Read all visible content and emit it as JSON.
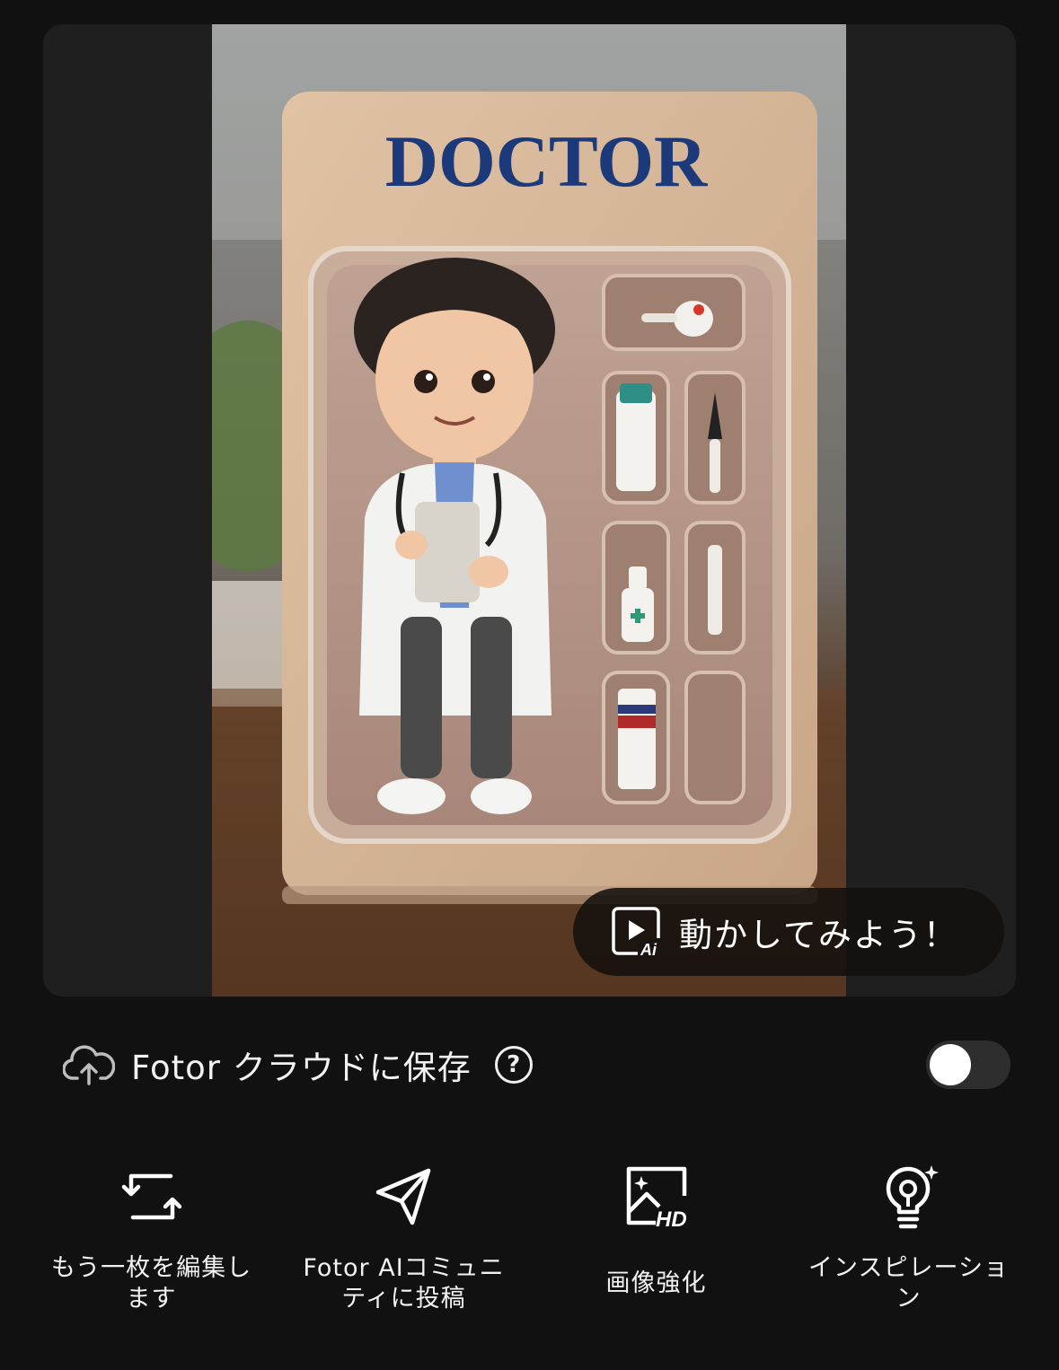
{
  "preview": {
    "image_alt": "3D doctor figure in blister toy package",
    "package_title": "DOCTOR",
    "animate_button_label": "動かしてみよう！",
    "animate_icon": "ai-play-icon"
  },
  "cloud_save": {
    "label": "Fotor クラウドに保存",
    "icon": "cloud-upload-icon",
    "help_icon": "help-icon",
    "help_glyph": "?",
    "toggle_on": false
  },
  "actions": [
    {
      "label": "もう一枚を編集します",
      "icon": "rotate-frame-icon"
    },
    {
      "label": "Fotor AIコミュニティに投稿",
      "icon": "send-icon"
    },
    {
      "label": "画像強化",
      "icon": "image-hd-icon"
    },
    {
      "label": "インスピレーション",
      "icon": "lightbulb-icon"
    }
  ],
  "colors": {
    "background": "#111111",
    "card": "#1f1f1f",
    "pill": "#14100e",
    "package": "#d9b99a",
    "title_blue": "#1c3a7a"
  }
}
